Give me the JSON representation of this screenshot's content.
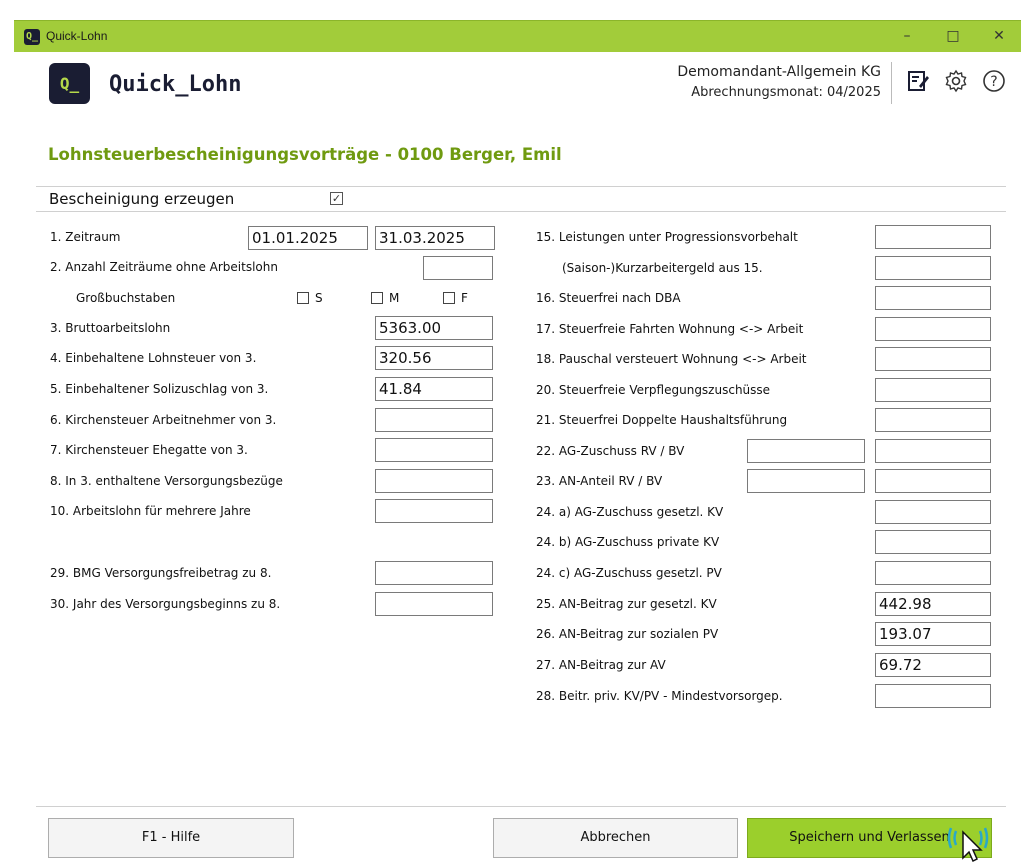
{
  "window": {
    "title": "Quick-Lohn",
    "logo_text": "Q_",
    "minimize": "–",
    "maximize": "□",
    "close": "✕"
  },
  "header": {
    "app_name": "Quick_Lohn",
    "logo_text": "Q_",
    "company": "Demomandant-Allgemein KG",
    "month": "Abrechnungsmonat: 04/2025",
    "icons": [
      "edit-icon",
      "settings-gear-icon",
      "help-circle-icon"
    ]
  },
  "page": {
    "title": "Lohnsteuerbescheinigungsvorträge - 0100 Berger, Emil"
  },
  "certificate": {
    "label": "Bescheinigung erzeugen",
    "checked": true,
    "check_mark": "✓"
  },
  "left": {
    "r1": {
      "label": "1.  Zeitraum",
      "from": "01.01.2025",
      "to": "31.03.2025"
    },
    "r2": {
      "label": "2.  Anzahl Zeiträume ohne Arbeitslohn",
      "value": ""
    },
    "grossbuchstaben": {
      "label": "Großbuchstaben",
      "s": "S",
      "m": "M",
      "f": "F"
    },
    "r3": {
      "label": "3.  Bruttoarbeitslohn",
      "value": "5363.00"
    },
    "r4": {
      "label": "4.  Einbehaltene Lohnsteuer von 3.",
      "value": "320.56"
    },
    "r5": {
      "label": "5.  Einbehaltener Solizuschlag von 3.",
      "value": "41.84"
    },
    "r6": {
      "label": "6.  Kirchensteuer Arbeitnehmer von 3.",
      "value": ""
    },
    "r7": {
      "label": "7.  Kirchensteuer Ehegatte von 3.",
      "value": ""
    },
    "r8": {
      "label": "8.  In 3. enthaltene Versorgungsbezüge",
      "value": ""
    },
    "r10": {
      "label": "10. Arbeitslohn für mehrere Jahre",
      "value": ""
    },
    "r29": {
      "label": "29. BMG Versorgungsfreibetrag zu 8.",
      "value": ""
    },
    "r30": {
      "label": "30. Jahr des Versorgungsbeginns zu 8.",
      "value": ""
    }
  },
  "right": {
    "r15": {
      "label": "15. Leistungen unter Progressionsvorbehalt",
      "value": ""
    },
    "r15b": {
      "label": "(Saison-)Kurzarbeitergeld aus 15.",
      "value": ""
    },
    "r16": {
      "label": "16. Steuerfrei nach DBA",
      "value": ""
    },
    "r17": {
      "label": "17. Steuerfreie Fahrten Wohnung <-> Arbeit",
      "value": ""
    },
    "r18": {
      "label": "18. Pauschal versteuert Wohnung <-> Arbeit",
      "value": ""
    },
    "r20": {
      "label": "20. Steuerfreie Verpflegungszuschüsse",
      "value": ""
    },
    "r21": {
      "label": "21. Steuerfrei Doppelte Haushaltsführung",
      "value": ""
    },
    "r22": {
      "label": "22. AG-Zuschuss RV / BV",
      "value_a": "",
      "value_b": ""
    },
    "r23": {
      "label": "23. AN-Anteil RV / BV",
      "value_a": "",
      "value_b": ""
    },
    "r24a": {
      "label": "24. a) AG-Zuschuss gesetzl. KV",
      "value": ""
    },
    "r24b": {
      "label": "24. b) AG-Zuschuss private KV",
      "value": ""
    },
    "r24c": {
      "label": "24. c) AG-Zuschuss gesetzl. PV",
      "value": ""
    },
    "r25": {
      "label": "25. AN-Beitrag zur gesetzl. KV",
      "value": "442.98"
    },
    "r26": {
      "label": "26. AN-Beitrag zur sozialen PV",
      "value": "193.07"
    },
    "r27": {
      "label": "27. AN-Beitrag zur AV",
      "value": "69.72"
    },
    "r28": {
      "label": "28. Beitr. priv. KV/PV - Mindestvorsorgep.",
      "value": ""
    }
  },
  "footer": {
    "help": "F1 - Hilfe",
    "cancel": "Abbrechen",
    "save": "Speichern und Verlassen"
  },
  "colors": {
    "accent_green": "#a2cc3a",
    "title_green": "#6f9a10",
    "save_green": "#9bcf2c",
    "logo_dark": "#1a1d33"
  }
}
